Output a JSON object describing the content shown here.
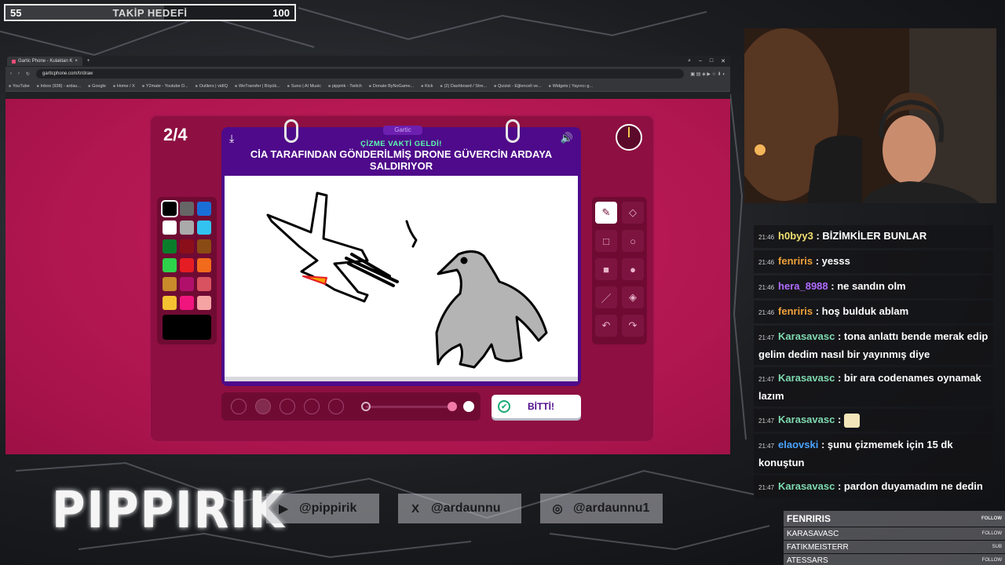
{
  "goal": {
    "current": "55",
    "title": "TAKİP HEDEFİ",
    "target": "100",
    "progress_fraction": 0.55
  },
  "browser": {
    "tab_title": "Gartic Phone - Kulaktan K",
    "url": "garticphone.com/tr/draw",
    "bookmarks": [
      "YouTube",
      "Inbox (938) - ardau...",
      "Google",
      "Home / X",
      "Y2mate - Youtube D...",
      "Outliers | vidIQ",
      "WeTransfer | Büyük...",
      "Suno | AI Music",
      "pippirik - Twitch",
      "Donate ByNoGame...",
      "Kick",
      "(2) Dashboard / Stre...",
      "Quizizi - Eğlenceli ve...",
      "Widgets | Yayıncı g..."
    ]
  },
  "game": {
    "round": "2/4",
    "brand": "Gartic",
    "prompt_sub": "ÇİZME VAKTİ GELDİ!",
    "prompt_main": "CİA TARAFINDAN GÖNDERİLMİŞ DRONE GÜVERCİN ARDAYA SALDIRIYOR",
    "done_label": "BİTTİ!",
    "colors": [
      "#000000",
      "#666666",
      "#1a6fd6",
      "#ffffff",
      "#aaaaaa",
      "#33c3f0",
      "#0a7d2b",
      "#8b0f1a",
      "#8a4b14",
      "#2ed14a",
      "#e51c23",
      "#f26a1b",
      "#c88a2b",
      "#b0106a",
      "#d9525f",
      "#f5c231",
      "#f0157d",
      "#f5a3a3"
    ],
    "current_color": "#000000",
    "tools": [
      "pencil-icon",
      "eraser-icon",
      "rect-outline-icon",
      "circle-outline-icon",
      "rect-fill-icon",
      "circle-fill-icon",
      "line-icon",
      "bucket-icon",
      "undo-icon",
      "redo-icon"
    ]
  },
  "chat": [
    {
      "time": "21:46",
      "user": "h0byy3",
      "color": "#f2e070",
      "text": "BİZİMKİLER BUNLAR"
    },
    {
      "time": "21:46",
      "user": "fenriris",
      "color": "#f0a13a",
      "text": "yesss"
    },
    {
      "time": "21:46",
      "user": "hera_8988",
      "color": "#b06cff",
      "text": "ne sandın olm"
    },
    {
      "time": "21:46",
      "user": "fenriris",
      "color": "#f0a13a",
      "text": "hoş bulduk ablam"
    },
    {
      "time": "21:47",
      "user": "Karasavasc",
      "color": "#7ed9b0",
      "text": "tona anlattı bende merak edip gelim dedim nasıl bir yayınmış diye"
    },
    {
      "time": "21:47",
      "user": "Karasavasc",
      "color": "#7ed9b0",
      "text": "bir ara codenames oynamak lazım"
    },
    {
      "time": "21:47",
      "user": "Karasavasc",
      "color": "#7ed9b0",
      "text": "",
      "emote": true
    },
    {
      "time": "21:47",
      "user": "elaovski",
      "color": "#4aa3ff",
      "text": "şunu çizmemek için 15 dk konuştun"
    },
    {
      "time": "21:47",
      "user": "Karasavasc",
      "color": "#7ed9b0",
      "text": "pardon duyamadım ne dedin"
    }
  ],
  "logo": "PIPPIRIK",
  "socials": [
    {
      "icon": "youtube-icon",
      "glyph": "▶",
      "handle": "@pippirik"
    },
    {
      "icon": "x-icon",
      "glyph": "X",
      "handle": "@ardaunnu"
    },
    {
      "icon": "instagram-icon",
      "glyph": "◎",
      "handle": "@ardaunnu1"
    }
  ],
  "follows": [
    {
      "name": "FENRIRIS",
      "tag": "FOLLOW"
    },
    {
      "name": "KARASAVASC",
      "tag": "FOLLOW"
    },
    {
      "name": "FATIKMEISTERR",
      "tag": "SUB"
    },
    {
      "name": "ATESSARS",
      "tag": "FOLLOW"
    }
  ]
}
